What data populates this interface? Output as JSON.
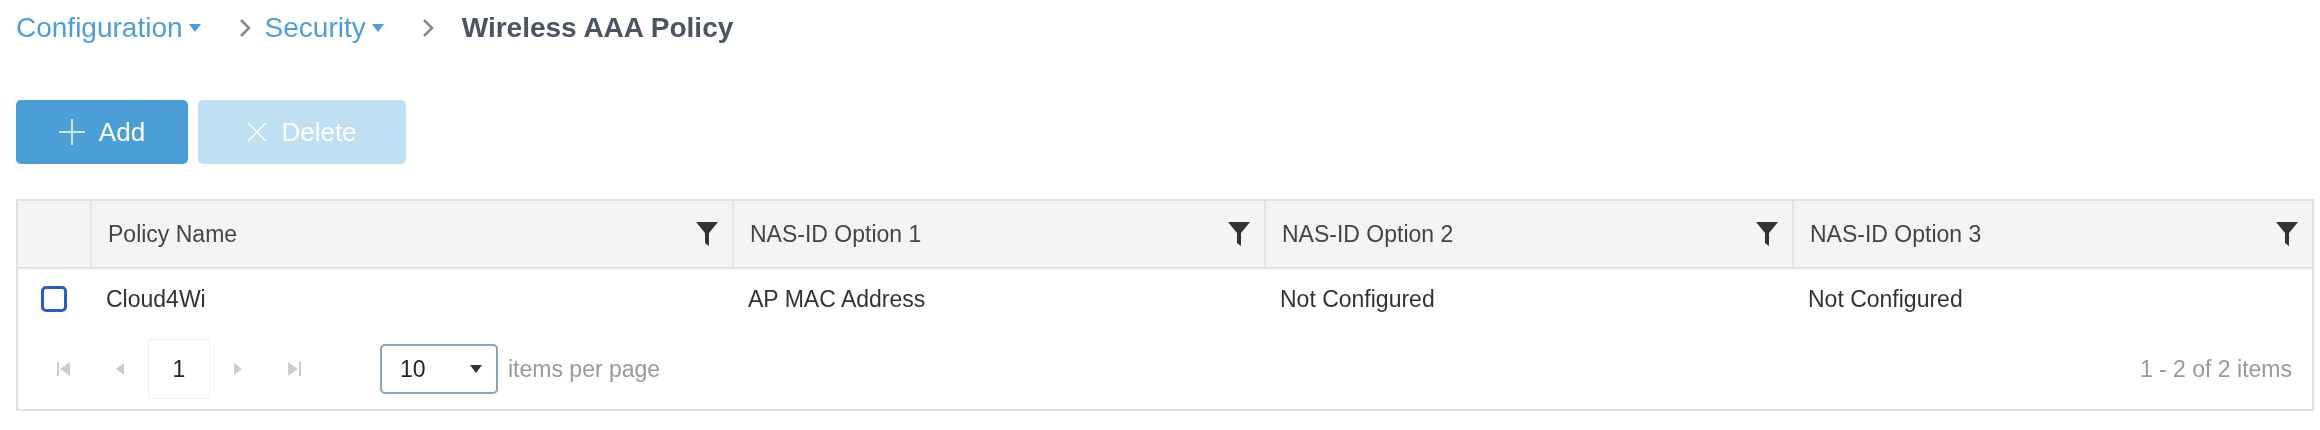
{
  "breadcrumb": [
    {
      "label": "Configuration",
      "kind": "dropdown"
    },
    {
      "label": "Security",
      "kind": "dropdown"
    },
    {
      "label": "Wireless AAA Policy",
      "kind": "current"
    }
  ],
  "toolbar": [
    {
      "label": "Add",
      "kind": "add",
      "disabled": false
    },
    {
      "label": "Delete",
      "kind": "delete",
      "disabled": true
    }
  ],
  "table": {
    "columns": [
      "Policy Name",
      "NAS-ID Option 1",
      "NAS-ID Option 2",
      "NAS-ID Option 3"
    ],
    "rows": [
      {
        "checked": false,
        "cells": [
          "Cloud4Wi",
          "AP MAC Address",
          "Not Configured",
          "Not Configured"
        ]
      }
    ]
  },
  "pager": {
    "page": "1",
    "page_size": "10",
    "page_size_label": "items per page",
    "summary": "1 - 2 of 2 items"
  }
}
